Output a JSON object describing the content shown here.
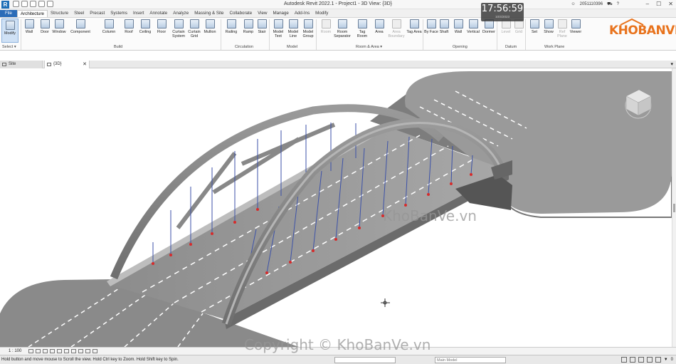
{
  "app": {
    "title": "Autodesk Revit 2022.1 - Project1 - 3D View: {3D}",
    "user": "2051110396",
    "clock": "17:56:59",
    "clock_sub": "10/4/2023"
  },
  "brand": {
    "text": "KHOBANVE"
  },
  "ribbon": {
    "tabs": [
      "File",
      "Architecture",
      "Structure",
      "Steel",
      "Precast",
      "Systems",
      "Insert",
      "Annotate",
      "Analyze",
      "Massing & Site",
      "Collaborate",
      "View",
      "Manage",
      "Add-Ins",
      "Modify"
    ],
    "active_tab": "Architecture",
    "modify": "Modify",
    "select": "Select ▾",
    "build": {
      "label": "Build",
      "items": [
        "Wall",
        "Door",
        "Window",
        "Component",
        "Column",
        "Roof",
        "Ceiling",
        "Floor",
        "Curtain System",
        "Curtain Grid",
        "Mullion"
      ]
    },
    "circulation": {
      "label": "Circulation",
      "items": [
        "Railing",
        "Ramp",
        "Stair"
      ]
    },
    "model": {
      "label": "Model",
      "items": [
        "Model Text",
        "Model Line",
        "Model Group"
      ]
    },
    "room_area": {
      "label": "Room & Area ▾",
      "items": [
        "Room",
        "Room Separator",
        "Tag Room",
        "Area",
        "Area Boundary",
        "Tag Area"
      ]
    },
    "opening": {
      "label": "Opening",
      "items": [
        "By Face",
        "Shaft",
        "Wall",
        "Vertical",
        "Dormer"
      ]
    },
    "datum": {
      "label": "Datum",
      "items": [
        "Level",
        "Grid"
      ]
    },
    "work_plane": {
      "label": "Work Plane",
      "items": [
        "Set",
        "Show",
        "Ref Plane",
        "Viewer"
      ]
    }
  },
  "view_tabs": [
    {
      "label": "Site"
    },
    {
      "label": "{3D}"
    }
  ],
  "viewbar": {
    "scale": "1 : 100"
  },
  "statusbar": {
    "message": "Hold button and move mouse to Scroll the view. Hold Ctrl key to Zoom. Hold Shift key to Spin.",
    "model_field": "Main Model",
    "filter_count": "0"
  },
  "watermarks": {
    "center": "KhoBanVe.vn",
    "bottom": "Copyright © KhoBanVe.vn"
  }
}
